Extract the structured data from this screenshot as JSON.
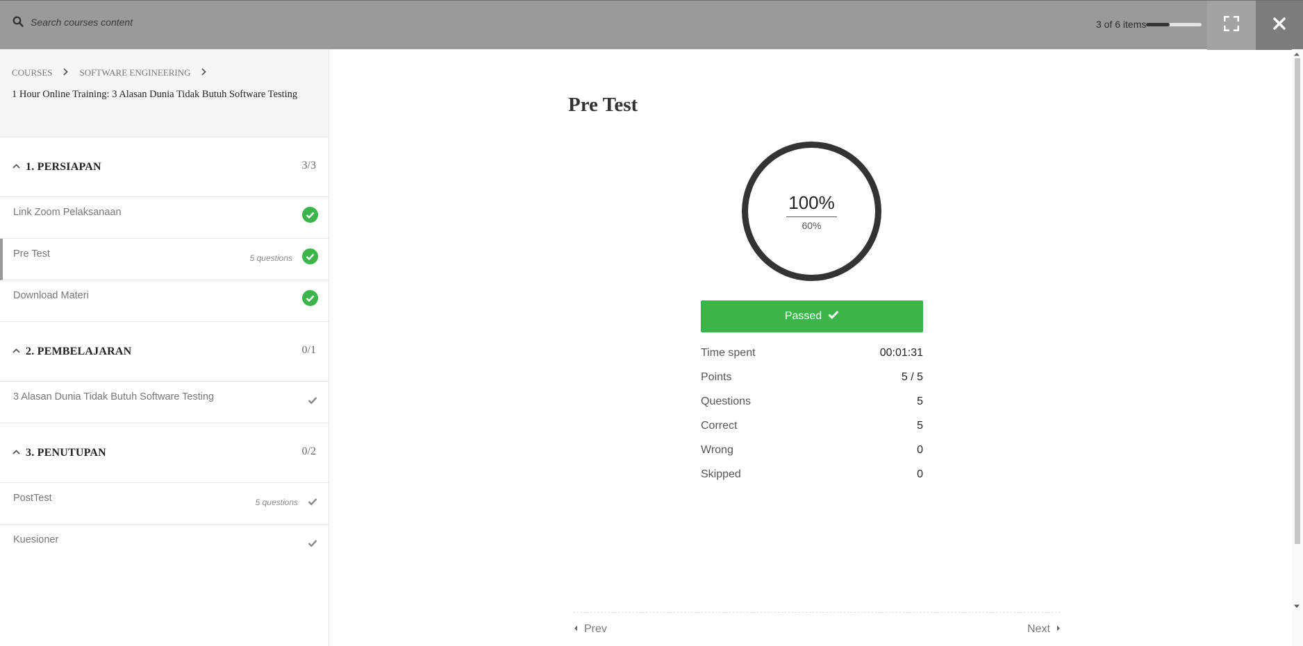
{
  "topbar": {
    "search_placeholder": "Search courses content",
    "progress_text": "3 of 6 items",
    "progress_fraction": 0.42
  },
  "sidebar": {
    "breadcrumb": [
      "COURSES",
      "SOFTWARE ENGINEERING"
    ],
    "course_title": "1 Hour Online Training: 3 Alasan Dunia Tidak Butuh Software Testing",
    "sections": [
      {
        "title": "1. PERSIAPAN",
        "count": "3/3",
        "items": [
          {
            "label": "Link Zoom Pelaksanaan",
            "meta": "",
            "status": "completed"
          },
          {
            "label": "Pre Test",
            "meta": "5 questions",
            "status": "completed"
          },
          {
            "label": "Download Materi",
            "meta": "",
            "status": "completed"
          }
        ]
      },
      {
        "title": "2. PEMBELAJARAN",
        "count": "0/1",
        "items": [
          {
            "label": "3 Alasan Dunia Tidak Butuh Software Testing",
            "meta": "",
            "status": "pending"
          }
        ]
      },
      {
        "title": "3. PENUTUPAN",
        "count": "0/2",
        "items": [
          {
            "label": "PostTest",
            "meta": "5 questions",
            "status": "pending"
          },
          {
            "label": "Kuesioner",
            "meta": "",
            "status": "pending"
          }
        ]
      }
    ]
  },
  "main": {
    "title": "Pre Test",
    "result_percent": "100%",
    "passing_percent": "60%",
    "status_label": "Passed",
    "stats": [
      {
        "label": "Time spent",
        "value": "00:01:31"
      },
      {
        "label": "Points",
        "value": "5 / 5"
      },
      {
        "label": "Questions",
        "value": "5"
      },
      {
        "label": "Correct",
        "value": "5"
      },
      {
        "label": "Wrong",
        "value": "0"
      },
      {
        "label": "Skipped",
        "value": "0"
      }
    ],
    "prev_label": "Prev",
    "next_label": "Next"
  },
  "colors": {
    "topbar": "#9a9a9a",
    "success": "#3bb54a",
    "dark": "#333333"
  },
  "icons": [
    "search-icon",
    "fullscreen-icon",
    "close-icon",
    "chevron-right-icon",
    "chevron-up-icon",
    "check-circle-icon",
    "check-icon",
    "caret-left-icon",
    "caret-right-icon"
  ]
}
